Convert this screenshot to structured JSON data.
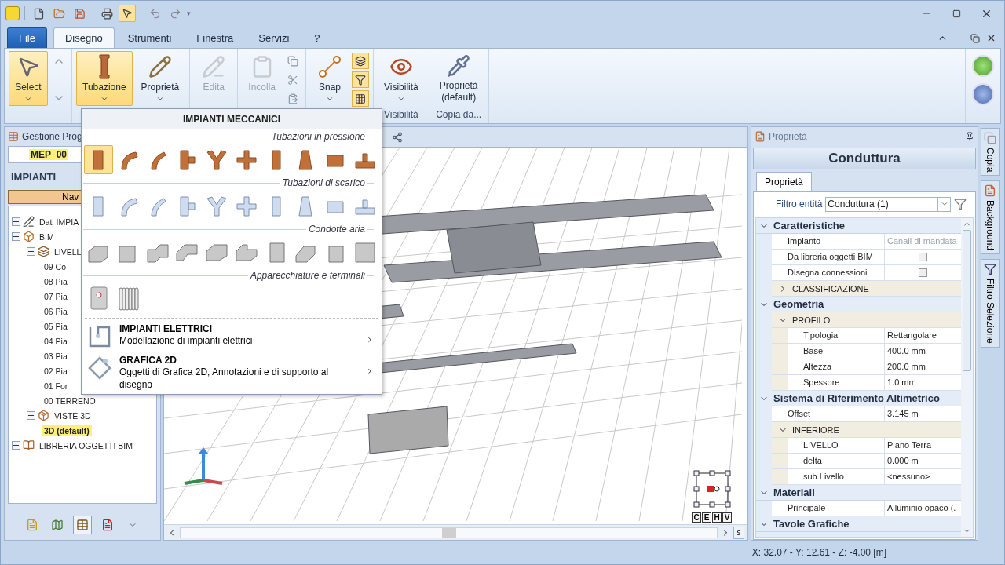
{
  "quick_access": {
    "dropdown": "▾"
  },
  "tabs": [
    {
      "label": "File",
      "kind": "file",
      "selected": false
    },
    {
      "label": "Disegno",
      "kind": "tab",
      "selected": true
    },
    {
      "label": "Strumenti",
      "kind": "tab",
      "selected": false
    },
    {
      "label": "Finestra",
      "kind": "tab",
      "selected": false
    },
    {
      "label": "Servizi",
      "kind": "tab",
      "selected": false
    },
    {
      "label": "?",
      "kind": "tab",
      "selected": false
    }
  ],
  "ribbon": [
    {
      "kind": "select",
      "buttons": [
        {
          "label": "Select",
          "selected": true,
          "disabled": false,
          "dropdown": true
        }
      ]
    },
    {
      "kind": "pipe",
      "buttons": [
        {
          "label": "Tubazione",
          "selected": true,
          "disabled": false,
          "dropdown": true
        },
        {
          "label": "Proprietà",
          "selected": false,
          "disabled": false,
          "dropdown": true
        }
      ]
    },
    {
      "kind": "edit",
      "buttons": [
        {
          "label": "Edita",
          "selected": false,
          "disabled": true,
          "dropdown": false
        }
      ]
    },
    {
      "kind": "clipboard",
      "buttons": [
        {
          "label": "Incolla",
          "selected": false,
          "disabled": true,
          "dropdown": false
        }
      ]
    },
    {
      "kind": "snap",
      "buttons": [
        {
          "label": "Snap",
          "selected": false,
          "disabled": false,
          "dropdown": true
        }
      ]
    },
    {
      "kind": "view",
      "label": "Visibilità",
      "buttons": [
        {
          "label": "Visibilità",
          "selected": false,
          "disabled": false,
          "dropdown": true
        }
      ]
    },
    {
      "kind": "copy",
      "label": "Copia da...",
      "buttons": [
        {
          "label": "Proprietà\n(default)",
          "selected": false,
          "disabled": false,
          "dropdown": false
        }
      ]
    }
  ],
  "menu": {
    "title": "IMPIANTI MECCANICI",
    "sections": [
      {
        "title": "Tubazioni in pressione",
        "kind": "copper",
        "items": [
          {
            "selected": true
          },
          {
            "selected": false
          },
          {
            "selected": false
          },
          {
            "selected": false
          },
          {
            "selected": false
          },
          {
            "selected": false
          },
          {
            "selected": false
          },
          {
            "selected": false
          },
          {
            "selected": false
          },
          {
            "selected": false
          }
        ]
      },
      {
        "title": "Tubazioni di scarico",
        "kind": "steel",
        "items": [
          {
            "selected": false
          },
          {
            "selected": false
          },
          {
            "selected": false
          },
          {
            "selected": false
          },
          {
            "selected": false
          },
          {
            "selected": false
          },
          {
            "selected": false
          },
          {
            "selected": false
          },
          {
            "selected": false
          },
          {
            "selected": false
          }
        ]
      },
      {
        "title": "Condotte aria",
        "kind": "duct",
        "items": [
          {
            "selected": false
          },
          {
            "selected": false
          },
          {
            "selected": false
          },
          {
            "selected": false
          },
          {
            "selected": false
          },
          {
            "selected": false
          },
          {
            "selected": false
          },
          {
            "selected": false
          },
          {
            "selected": false
          },
          {
            "selected": false
          }
        ]
      },
      {
        "title": "Apparecchiature e terminali",
        "kind": "equipment",
        "items": [
          {
            "selected": false
          },
          {
            "selected": false
          }
        ]
      }
    ],
    "entries": [
      {
        "kind": "electric",
        "title": "IMPIANTI ELETTRICI",
        "description": "Modellazione di impianti elettrici"
      },
      {
        "kind": "graphic",
        "title": "GRAFICA 2D",
        "description": "Oggetti di Grafica 2D, Annotazioni e di supporto al disegno"
      }
    ]
  },
  "project_panel": {
    "title": "Gestione Prog",
    "project": "MEP_00",
    "header": "IMPIANTI",
    "nav_button": "Nav",
    "tree": [
      {
        "label": "Dati IMPIA",
        "kind": "data",
        "selected": false,
        "expanded": false
      },
      {
        "label": "BIM",
        "kind": "bim",
        "selected": false,
        "expanded": true,
        "children": [
          {
            "label": "LIVELL",
            "kind": "levels",
            "selected": false,
            "expanded": true,
            "children": [
              {
                "label": "09 Co",
                "selected": false
              },
              {
                "label": "08 Pia",
                "selected": false
              },
              {
                "label": "07 Pia",
                "selected": false
              },
              {
                "label": "06 Pia",
                "selected": false
              },
              {
                "label": "05 Pia",
                "selected": false
              },
              {
                "label": "04 Pia",
                "selected": false
              },
              {
                "label": "03 Pia",
                "selected": false
              },
              {
                "label": "02 Pia",
                "selected": false
              },
              {
                "label": "01 For",
                "selected": false
              },
              {
                "label": "00 TERRENO",
                "selected": false
              }
            ]
          },
          {
            "label": "VISTE 3D",
            "kind": "views",
            "selected": false,
            "expanded": true,
            "children": [
              {
                "label": "3D (default)",
                "selected": true
              }
            ]
          }
        ]
      },
      {
        "label": "LIBRERIA OGGETTI BIM",
        "kind": "library",
        "selected": false,
        "expanded": false
      }
    ]
  },
  "viewport": {
    "view_buttons": [
      "C",
      "E",
      "H",
      "V"
    ],
    "corner_button": "s"
  },
  "properties": {
    "panel_title": "Proprietà",
    "title": "Conduttura",
    "tab": "Proprietà",
    "filter_label": "Filtro entità",
    "filter_value": "Conduttura (1)",
    "sections": [
      {
        "title": "Caratteristiche",
        "expanded": true,
        "items": [
          {
            "kind": "row",
            "label": "Impianto",
            "value": "Canali di mandata",
            "disabled": true
          },
          {
            "kind": "check",
            "label": "Da libreria oggetti BIM",
            "checked": false
          },
          {
            "kind": "check",
            "label": "Disegna connessioni",
            "checked": false
          },
          {
            "kind": "group",
            "label": "CLASSIFICAZIONE",
            "expanded": false
          }
        ]
      },
      {
        "title": "Geometria",
        "expanded": true,
        "items": [
          {
            "kind": "group",
            "label": "PROFILO",
            "expanded": true,
            "children": [
              {
                "kind": "row",
                "label": "Tipologia",
                "value": "Rettangolare",
                "disabled": false
              },
              {
                "kind": "row",
                "label": "Base",
                "value": "400.0 mm",
                "disabled": false
              },
              {
                "kind": "row",
                "label": "Altezza",
                "value": "200.0 mm",
                "disabled": false
              },
              {
                "kind": "row",
                "label": "Spessore",
                "value": "1.0 mm",
                "disabled": false
              }
            ]
          }
        ]
      },
      {
        "title": "Sistema di Riferimento Altimetrico",
        "expanded": true,
        "items": [
          {
            "kind": "row",
            "label": "Offset",
            "value": "3.145 m",
            "disabled": false
          },
          {
            "kind": "group",
            "label": "INFERIORE",
            "expanded": true,
            "children": [
              {
                "kind": "row",
                "label": "LIVELLO",
                "value": "Piano Terra",
                "disabled": false
              },
              {
                "kind": "row",
                "label": "delta",
                "value": "0.000 m",
                "disabled": false
              },
              {
                "kind": "row",
                "label": "sub Livello",
                "value": "<nessuno>",
                "disabled": false
              }
            ]
          }
        ]
      },
      {
        "title": "Materiali",
        "expanded": true,
        "items": [
          {
            "kind": "row",
            "label": "Principale",
            "value": "Alluminio opaco (.",
            "disabled": false
          }
        ]
      },
      {
        "title": "Tavole Grafiche",
        "expanded": true
      }
    ]
  },
  "side_tabs": [
    {
      "label": "Copia",
      "kind": "copy"
    },
    {
      "label": "Background",
      "kind": "background"
    },
    {
      "label": "Filtro Selezione",
      "kind": "filter"
    }
  ],
  "status_bar": {
    "coordinates": "X: 32.07 - Y: 12.61 - Z: -4.00 [m]"
  }
}
